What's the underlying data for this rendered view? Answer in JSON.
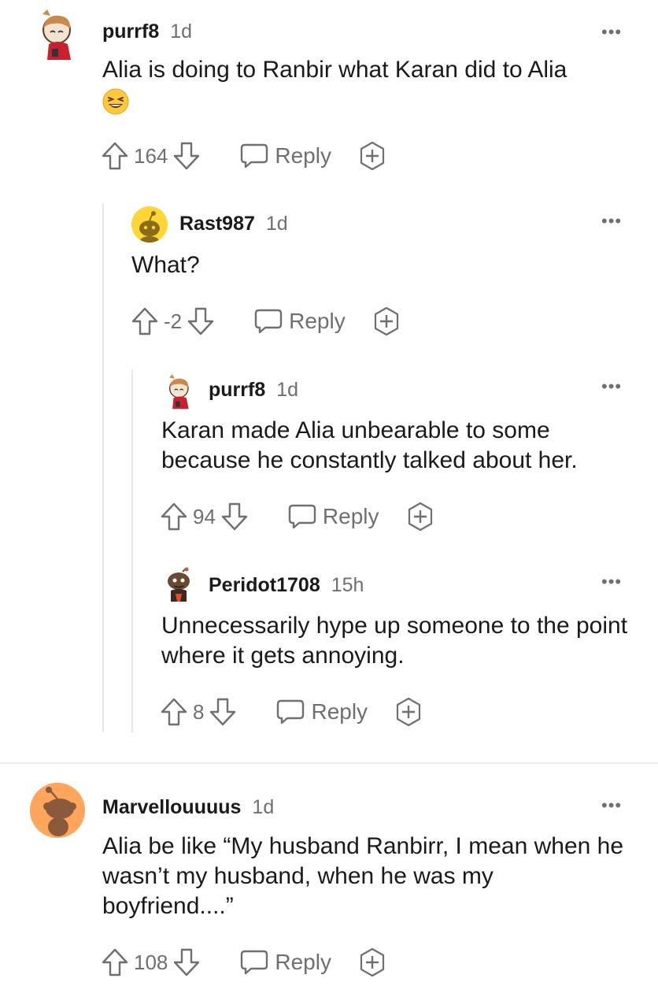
{
  "comments": [
    {
      "username": "purrf8",
      "time": "1d",
      "body": "Alia is doing to Ranbir what Karan did to Alia",
      "emoji": "😆",
      "votes": "164",
      "reply_label": "Reply",
      "more_label": "•••"
    },
    {
      "username": "Rast987",
      "time": "1d",
      "body": "What?",
      "votes": "-2",
      "reply_label": "Reply",
      "more_label": "•••"
    },
    {
      "username": "purrf8",
      "time": "1d",
      "body": "Karan made Alia unbearable to some because he constantly talked about her.",
      "votes": "94",
      "reply_label": "Reply",
      "more_label": "•••"
    },
    {
      "username": "Peridot1708",
      "time": "15h",
      "body": "Unnecessarily hype up someone to the point where it gets annoying.",
      "votes": "8",
      "reply_label": "Reply",
      "more_label": "•••"
    },
    {
      "username": "Marvellouuuus",
      "time": "1d",
      "body": "Alia be like “My husband Ranbirr, I mean when he wasn’t my husband, when he was my boyfriend....”",
      "votes": "108",
      "reply_label": "Reply",
      "more_label": "•••"
    }
  ],
  "icons": {
    "upvote": "upvote-arrow-icon",
    "downvote": "downvote-arrow-icon",
    "reply": "speech-bubble-icon",
    "award": "plus-award-icon",
    "more": "horizontal-ellipsis-icon"
  }
}
